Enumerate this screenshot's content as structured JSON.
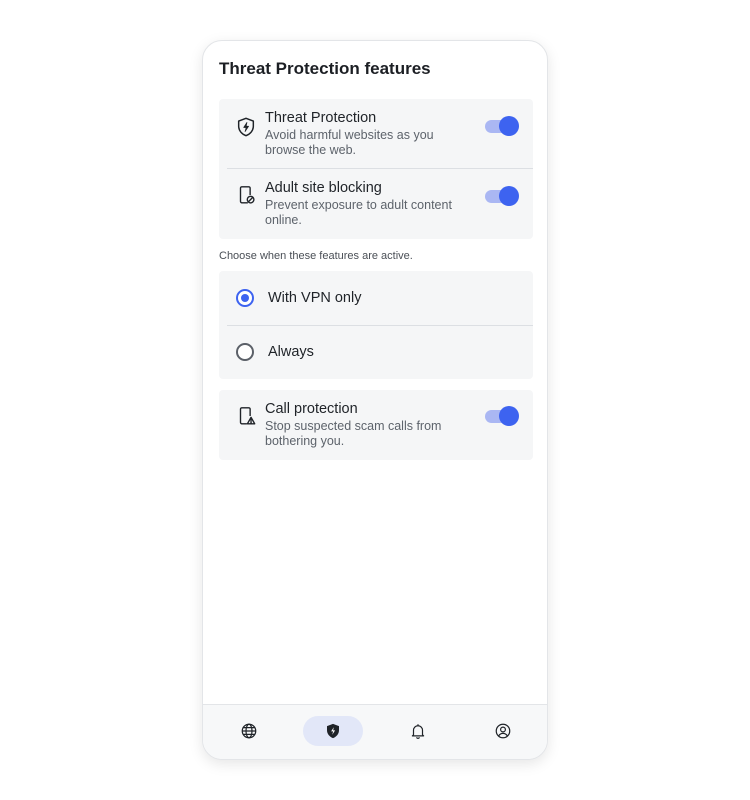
{
  "title": "Threat Protection features",
  "features": [
    {
      "label": "Threat Protection",
      "description": "Avoid harmful websites as you browse the web.",
      "icon": "shield-bolt-icon",
      "enabled": true
    },
    {
      "label": "Adult site blocking",
      "description": "Prevent exposure to adult content online.",
      "icon": "phone-block-icon",
      "enabled": true
    }
  ],
  "mode_hint": "Choose when these features are active.",
  "mode_options": [
    {
      "label": "With VPN only",
      "selected": true
    },
    {
      "label": "Always",
      "selected": false
    }
  ],
  "call_protection": {
    "label": "Call protection",
    "description": "Stop suspected scam calls from bothering you.",
    "icon": "phone-warning-icon",
    "enabled": true
  },
  "bottom_nav": [
    {
      "icon": "globe-icon",
      "active": false
    },
    {
      "icon": "shield-bolt-icon",
      "active": true
    },
    {
      "icon": "bell-icon",
      "active": false
    },
    {
      "icon": "profile-icon",
      "active": false
    }
  ],
  "colors": {
    "accent": "#3d63f0",
    "toggle_track": "#aab7f3",
    "card_background": "#f5f6f7",
    "active_nav_pill": "#e2e7f8"
  }
}
